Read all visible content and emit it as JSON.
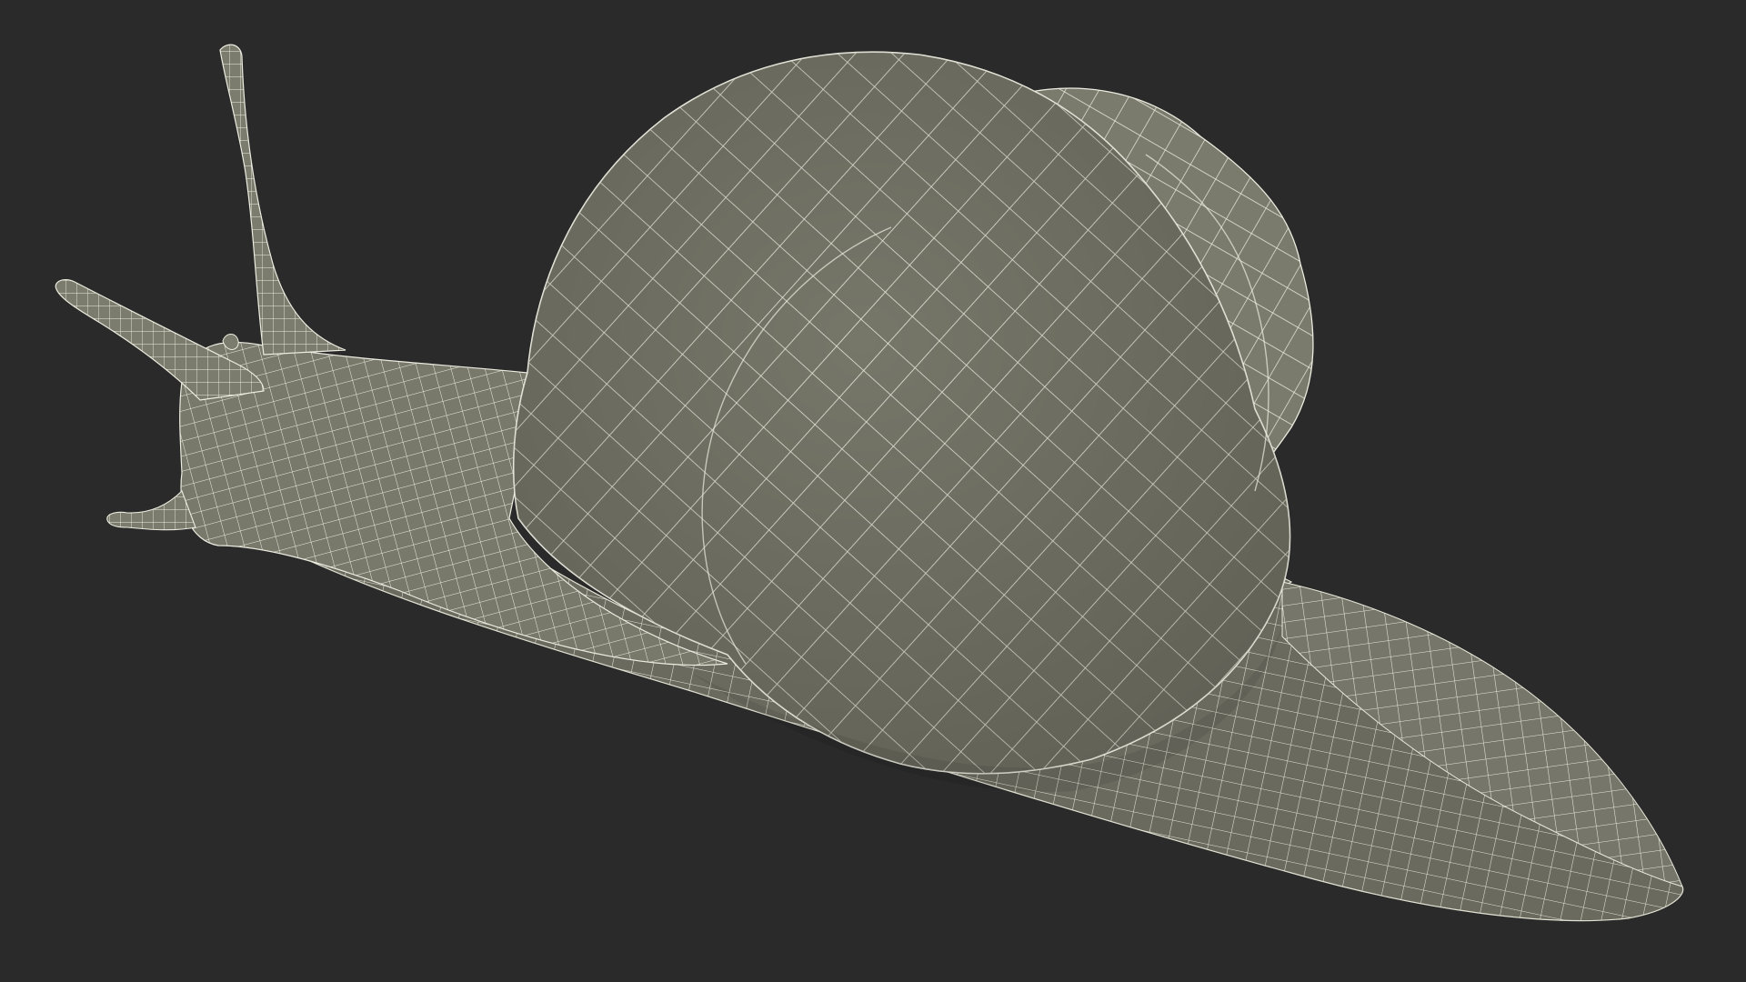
{
  "scene": {
    "subject": "snail",
    "render_style": "wireframe",
    "colors": {
      "background": "#2a2a2a",
      "surface": "#7a7a6e",
      "surface_shadow": "#5e5e54",
      "wire": "#e9e9dc"
    }
  }
}
